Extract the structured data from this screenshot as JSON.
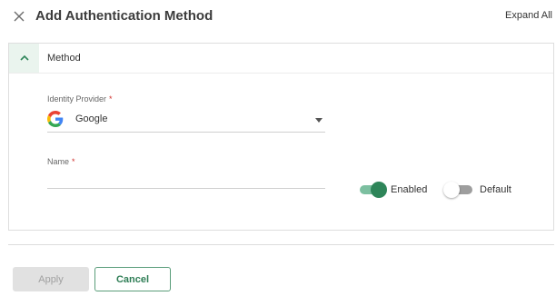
{
  "dialog": {
    "title": "Add Authentication Method",
    "expand_all_label": "Expand All"
  },
  "section": {
    "label": "Method",
    "expanded": true
  },
  "identity_provider": {
    "label": "Identity Provider",
    "required_mark": "*",
    "selected_value": "Google",
    "icon": "google-icon"
  },
  "name_field": {
    "label": "Name",
    "required_mark": "*",
    "value": "",
    "placeholder": ""
  },
  "toggles": {
    "enabled": {
      "label": "Enabled",
      "on": true
    },
    "default": {
      "label": "Default",
      "on": false
    }
  },
  "footer": {
    "apply_label": "Apply",
    "cancel_label": "Cancel"
  },
  "colors": {
    "accent": "#2e8559",
    "accent_light": "#7cbfa0",
    "section_header_bg": "#eaf4ee",
    "required": "#d0312d",
    "disabled_button": "#e1e1e1"
  }
}
